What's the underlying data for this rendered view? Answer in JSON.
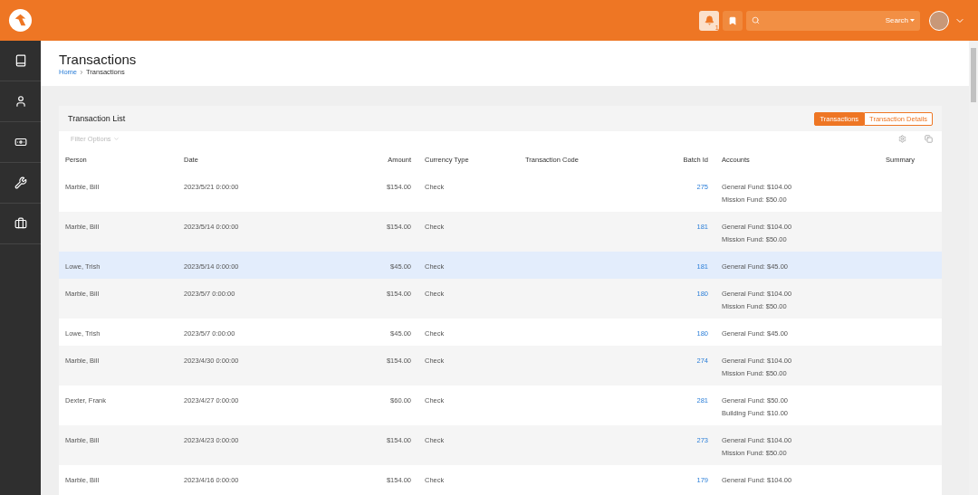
{
  "header": {
    "notification_count": "1",
    "search_button": "Search"
  },
  "page": {
    "title": "Transactions",
    "breadcrumb": [
      "Home",
      "Transactions"
    ]
  },
  "card": {
    "title": "Transaction List",
    "toggle": [
      {
        "label": "Transactions",
        "selected": true
      },
      {
        "label": "Transaction Details",
        "selected": false
      }
    ],
    "filter": "Filter Options"
  },
  "table": {
    "columns": [
      "Person",
      "Date",
      "Amount",
      "Currency Type",
      "Transaction Code",
      "Batch Id",
      "Accounts",
      "Summary"
    ],
    "rows": [
      {
        "person": "Marble, Bill",
        "date": "2023/5/21 0:00:00",
        "amount": "$154.00",
        "currency_type": "Check",
        "batch_id": "275",
        "accounts": [
          "General Fund: $104.00",
          "Mission Fund: $50.00"
        ],
        "highlighted": false
      },
      {
        "person": "Marble, Bill",
        "date": "2023/5/14 0:00:00",
        "amount": "$154.00",
        "currency_type": "Check",
        "batch_id": "181",
        "accounts": [
          "General Fund: $104.00",
          "Mission Fund: $50.00"
        ],
        "highlighted": false
      },
      {
        "person": "Lowe, Trish",
        "date": "2023/5/14 0:00:00",
        "amount": "$45.00",
        "currency_type": "Check",
        "batch_id": "181",
        "accounts": [
          "General Fund: $45.00"
        ],
        "highlighted": true
      },
      {
        "person": "Marble, Bill",
        "date": "2023/5/7 0:00:00",
        "amount": "$154.00",
        "currency_type": "Check",
        "batch_id": "180",
        "accounts": [
          "General Fund: $104.00",
          "Mission Fund: $50.00"
        ],
        "highlighted": false
      },
      {
        "person": "Lowe, Trish",
        "date": "2023/5/7 0:00:00",
        "amount": "$45.00",
        "currency_type": "Check",
        "batch_id": "180",
        "accounts": [
          "General Fund: $45.00"
        ],
        "highlighted": false
      },
      {
        "person": "Marble, Bill",
        "date": "2023/4/30 0:00:00",
        "amount": "$154.00",
        "currency_type": "Check",
        "batch_id": "274",
        "accounts": [
          "General Fund: $104.00",
          "Mission Fund: $50.00"
        ],
        "highlighted": false
      },
      {
        "person": "Dexter, Frank",
        "date": "2023/4/27 0:00:00",
        "amount": "$60.00",
        "currency_type": "Check",
        "batch_id": "281",
        "accounts": [
          "General Fund: $50.00",
          "Building Fund: $10.00"
        ],
        "highlighted": false
      },
      {
        "person": "Marble, Bill",
        "date": "2023/4/23 0:00:00",
        "amount": "$154.00",
        "currency_type": "Check",
        "batch_id": "273",
        "accounts": [
          "General Fund: $104.00",
          "Mission Fund: $50.00"
        ],
        "highlighted": false
      },
      {
        "person": "Marble, Bill",
        "date": "2023/4/16 0:00:00",
        "amount": "$154.00",
        "currency_type": "Check",
        "batch_id": "179",
        "accounts": [
          "General Fund: $104.00"
        ],
        "highlighted": false
      }
    ]
  }
}
